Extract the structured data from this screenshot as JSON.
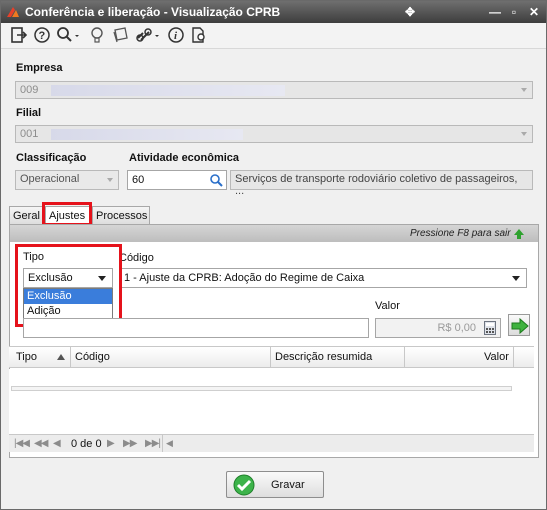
{
  "window": {
    "title": "Conferência e liberação - Visualização CPRB"
  },
  "labels": {
    "empresa": "Empresa",
    "filial": "Filial",
    "classificacao": "Classificação",
    "atividade": "Atividade econômica",
    "tipo": "Tipo",
    "codigo": "Código",
    "valor": "Valor"
  },
  "fields": {
    "empresa_value": "009",
    "filial_value": "001",
    "classificacao_value": "Operacional",
    "atividade_code": "60",
    "atividade_desc": "Serviços de transporte rodoviário coletivo de passageiros, ...",
    "tipo_selected": "Exclusão",
    "codigo_selected": "1 - Ajuste da CPRB: Adoção do Regime de Caixa",
    "valor_placeholder": "R$ 0,00"
  },
  "tabs": [
    {
      "label": "Geral"
    },
    {
      "label": "Ajustes"
    },
    {
      "label": "Processos"
    }
  ],
  "panel": {
    "hint": "Pressione F8 para sair"
  },
  "tipo_options": [
    "Exclusão",
    "Adição"
  ],
  "grid": {
    "columns": [
      "Tipo",
      "Código",
      "Descrição resumida",
      "Valor"
    ]
  },
  "pager": {
    "text": "0 de 0"
  },
  "footer": {
    "save_label": "Gravar"
  }
}
